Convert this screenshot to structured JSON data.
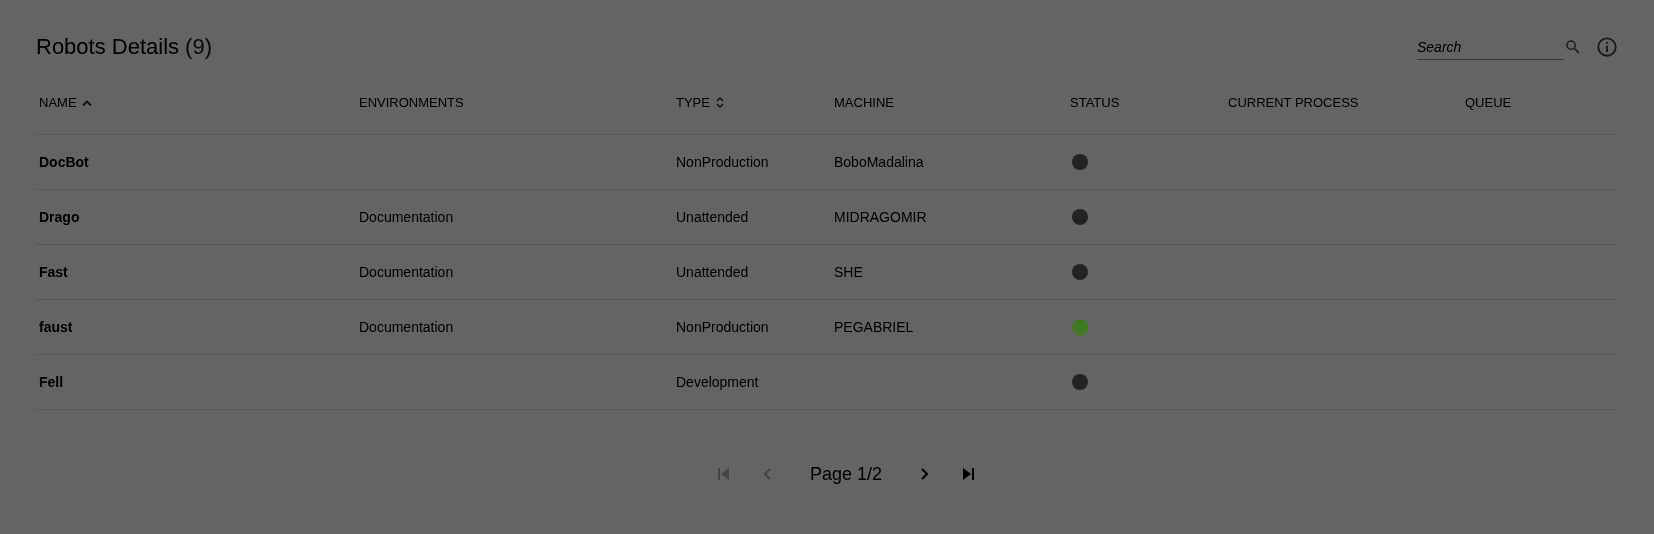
{
  "header": {
    "title": "Robots Details",
    "count": "(9)",
    "search": {
      "placeholder": "Search"
    }
  },
  "table": {
    "columns": [
      {
        "label": "NAME",
        "sortable": true,
        "sorted_ascending": true
      },
      {
        "label": "ENVIRONMENTS"
      },
      {
        "label": "TYPE",
        "sortable": true,
        "sorted_ascending": false
      },
      {
        "label": "MACHINE"
      },
      {
        "label": "STATUS"
      },
      {
        "label": "CURRENT PROCESS"
      },
      {
        "label": "QUEUE"
      }
    ],
    "rows": [
      {
        "name": "DocBot",
        "type": "NonProduction",
        "machine": "BoboMadalina",
        "color": "#232325"
      },
      {
        "name": "Drago",
        "environments": "Documentation",
        "type": "Unattended",
        "machine": "MIDRAGOMIR",
        "color": "#232325"
      },
      {
        "name": "Fast",
        "environments": "Documentation",
        "type": "Unattended",
        "machine": "SHE",
        "color": "#232325"
      },
      {
        "name": "faust",
        "environments": "Documentation",
        "type": "NonProduction",
        "machine": "PEGABRIEL",
        "color": "#3d7a22"
      },
      {
        "name": "Fell",
        "type": "Development",
        "color": "#232325"
      }
    ]
  },
  "pager": {
    "label": "Page 1/2",
    "first_disabled": true,
    "prev_disabled": true,
    "next_disabled": false,
    "last_disabled": false
  }
}
